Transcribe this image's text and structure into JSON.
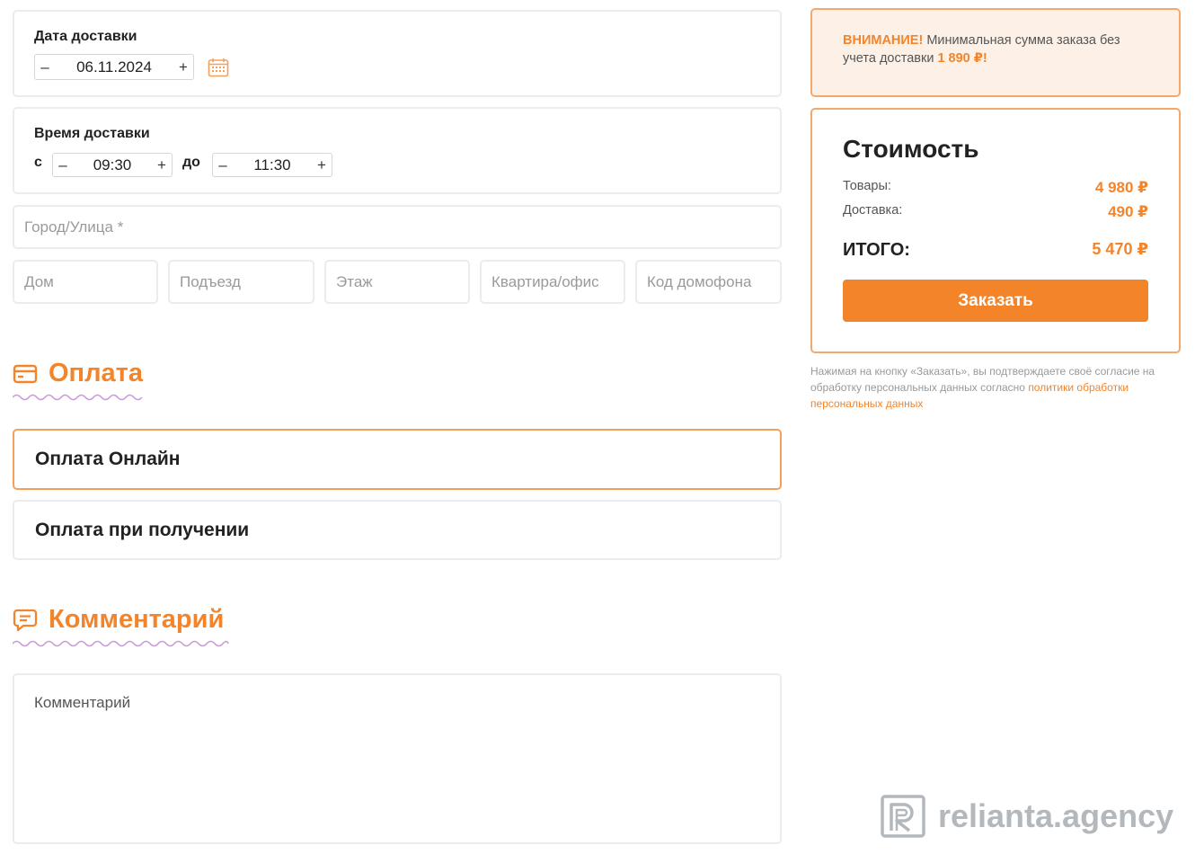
{
  "delivery_date": {
    "label": "Дата доставки",
    "value": "06.11.2024",
    "minus": "–",
    "plus": "+"
  },
  "delivery_time": {
    "label": "Время доставки",
    "from_label": "с",
    "to_label": "до",
    "from_value": "09:30",
    "to_value": "11:30",
    "minus": "–",
    "plus": "+"
  },
  "address": {
    "street_placeholder": "Город/Улица *",
    "house_placeholder": "Дом",
    "entrance_placeholder": "Подъезд",
    "floor_placeholder": "Этаж",
    "apartment_placeholder": "Квартира/офис",
    "intercom_placeholder": "Код домофона"
  },
  "payment": {
    "title": "Оплата",
    "options": [
      {
        "label": "Оплата Онлайн",
        "selected": true
      },
      {
        "label": "Оплата при получении",
        "selected": false
      }
    ]
  },
  "comment": {
    "title": "Комментарий",
    "placeholder": "Комментарий"
  },
  "warning": {
    "prefix": "ВНИМАНИЕ!",
    "text": " Минимальная сумма заказа без учета доставки ",
    "amount": "1 890 ₽!"
  },
  "cost": {
    "title": "Стоимость",
    "goods_label": "Товары:",
    "goods_value": "4 980 ₽",
    "delivery_label": "Доставка:",
    "delivery_value": "490 ₽",
    "total_label": "ИТОГО:",
    "total_value": "5 470 ₽",
    "order_button": "Заказать"
  },
  "consent": {
    "text": "Нажимая на кнопку «Заказать», вы подтверждаете своё согласие на обработку персональных данных согласно ",
    "link": "политики обработки персональных данных"
  },
  "watermark": {
    "text": "relianta.agency"
  },
  "colors": {
    "accent": "#f4842a",
    "wave": "#c99bd6",
    "border": "#ececec"
  }
}
